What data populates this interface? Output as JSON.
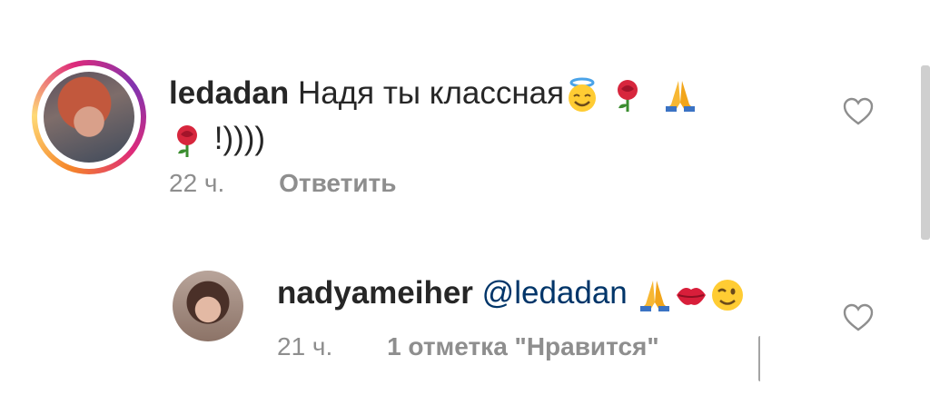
{
  "comments": [
    {
      "username": "ledadan",
      "text_line1": "Надя ты классная",
      "text_line2": "!))))",
      "time": "22 ч.",
      "reply_label": "Ответить",
      "emojis": [
        "smiling-face-with-halo",
        "rose",
        "folded-hands",
        "rose"
      ]
    },
    {
      "username": "nadyameiher",
      "mention": "@ledadan",
      "time": "21 ч.",
      "likes_label": "1 отметка \"Нравится\"",
      "emojis": [
        "folded-hands",
        "kiss-mark",
        "winking-face"
      ]
    }
  ],
  "colors": {
    "text": "#262626",
    "meta": "#8e8e8e",
    "mention": "#003569",
    "story_ring": [
      "#f58529",
      "#dd2a7b",
      "#8134af"
    ]
  }
}
